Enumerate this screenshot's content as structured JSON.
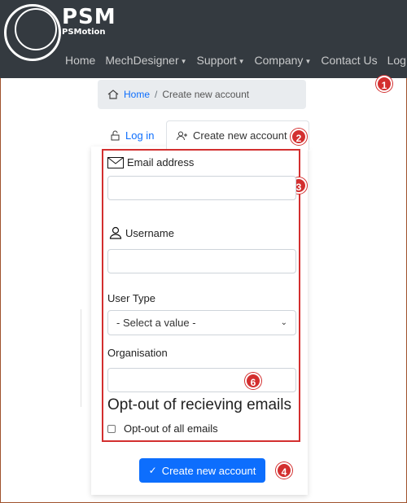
{
  "brand": {
    "logo_main": "PSM",
    "logo_sub": "PSMotion"
  },
  "nav": {
    "items": [
      {
        "label": "Home",
        "dropdown": false
      },
      {
        "label": "MechDesigner",
        "dropdown": true
      },
      {
        "label": "Support",
        "dropdown": true
      },
      {
        "label": "Company",
        "dropdown": true
      },
      {
        "label": "Contact Us",
        "dropdown": false
      },
      {
        "label": "Log in",
        "dropdown": false
      }
    ]
  },
  "breadcrumb": {
    "home": "Home",
    "separator": "/",
    "current": "Create new account"
  },
  "tabs": {
    "login": "Log in",
    "create": "Create new account"
  },
  "form": {
    "email_label": "Email address",
    "email_value": "",
    "username_label": "Username",
    "username_value": "",
    "user_type_label": "User Type",
    "user_type_selected": "- Select a value -",
    "organisation_label": "Organisation",
    "organisation_value": "",
    "optout_heading": "Opt-out of recieving emails",
    "optout_checkbox_label": "Opt-out of all emails",
    "optout_checked": false,
    "submit_label": "Create new account"
  },
  "callouts": [
    "1",
    "2",
    "3",
    "4",
    "6"
  ],
  "colors": {
    "navbar_bg": "#343a40",
    "accent": "#0d6efd",
    "callout": "#d32f2f"
  }
}
